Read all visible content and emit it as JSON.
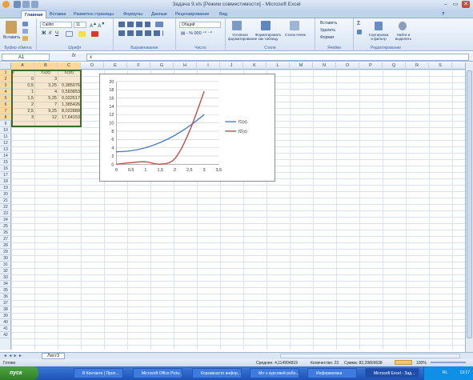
{
  "window": {
    "title": "Задача 9.xls  [Режим совместимости] - Microsoft Excel",
    "controls": [
      "–",
      "▭",
      "✕"
    ]
  },
  "ribbon_tabs": [
    "Главная",
    "Вставка",
    "Разметка страницы",
    "Формулы",
    "Данные",
    "Рецензирование",
    "Вид"
  ],
  "ribbon": {
    "clipboard": {
      "paste": "Вставить",
      "label": "Буфер обмена"
    },
    "font": {
      "name": "Calibri",
      "size": "11",
      "label": "Шрифт"
    },
    "alignment": {
      "label": "Выравнивание"
    },
    "number": {
      "format": "Общий",
      "label": "Число"
    },
    "styles": {
      "conditional": "Условное форматирование",
      "table": "Форматировать как таблицу",
      "cell_styles": "Стили ячеек",
      "label": "Стили"
    },
    "cells": {
      "insert": "Вставить",
      "delete": "Удалить",
      "format": "Формат",
      "label": "Ячейки"
    },
    "editing": {
      "sort": "Сортировка и фильтр",
      "find": "Найти и выделить",
      "label": "Редактирование"
    }
  },
  "formula_bar": {
    "name_box": "A1",
    "fx": "fx",
    "formula": "x"
  },
  "columns": [
    "A",
    "B",
    "C",
    "D",
    "E",
    "F",
    "G",
    "H",
    "I",
    "J",
    "K",
    "L",
    "M",
    "N",
    "O",
    "P",
    "Q",
    "R",
    "S"
  ],
  "rows": [
    "1",
    "2",
    "3",
    "4",
    "5",
    "6",
    "7",
    "8",
    "9",
    "10",
    "11",
    "12",
    "13",
    "14",
    "15",
    "16",
    "17",
    "18",
    "19",
    "20",
    "21",
    "22",
    "23",
    "24",
    "25",
    "26",
    "27",
    "28",
    "29",
    "30",
    "31",
    "32",
    "33",
    "34",
    "35",
    "36",
    "37",
    "38",
    "39",
    "40",
    "41",
    "42"
  ],
  "table": {
    "headers": [
      "x",
      "f1(x)",
      "f2(x)"
    ],
    "rows": [
      [
        "0",
        "3",
        ""
      ],
      [
        "0,5",
        "3,25",
        "0,385076"
      ],
      [
        "1",
        "4",
        "0,583853"
      ],
      [
        "1,5",
        "5,25",
        "0,022517"
      ],
      [
        "2",
        "7",
        "1,385426"
      ],
      [
        "2,5",
        "9,25",
        "8,022889"
      ],
      [
        "3",
        "12",
        "17,64153"
      ]
    ]
  },
  "chart_data": {
    "type": "line",
    "x": [
      0,
      0.5,
      1,
      1.5,
      2,
      2.5,
      3
    ],
    "x_ticks": [
      "0",
      "0,5",
      "1",
      "1,5",
      "2",
      "2,5",
      "3",
      "3,5"
    ],
    "y_ticks": [
      "0",
      "2",
      "4",
      "6",
      "8",
      "10",
      "12",
      "14",
      "16",
      "18",
      "20"
    ],
    "xlim": [
      0,
      3.5
    ],
    "ylim": [
      0,
      20
    ],
    "grid": true,
    "legend_position": "right",
    "series": [
      {
        "name": "f1(x)",
        "values": [
          3,
          3.25,
          4,
          5.25,
          7,
          9.25,
          12
        ],
        "color": "#4a7ebb"
      },
      {
        "name": "f2(x)",
        "values": [
          0,
          0.385076,
          0.583853,
          0.022517,
          1.385426,
          8.022889,
          17.64153
        ],
        "color": "#be4b48"
      }
    ]
  },
  "sheet_tabs": {
    "nav": "◄ ◄ ► ►",
    "current": "Лист3"
  },
  "status": {
    "mode": "Готово",
    "average": "Среднее: 4,114904819",
    "count": "Количество: 23",
    "sum": "Сумма: 82,29809638",
    "zoom": "100%"
  },
  "taskbar": {
    "start": "пуск",
    "items": [
      "В Контакте | Проп...",
      "Microsoft Office Pictu...",
      "Корзавнасто инфор...",
      "Мгг к курсовой рабо...",
      "Информатика",
      "Microsoft Excel - Зад..."
    ],
    "clock": "13:17",
    "lang": "RL"
  }
}
